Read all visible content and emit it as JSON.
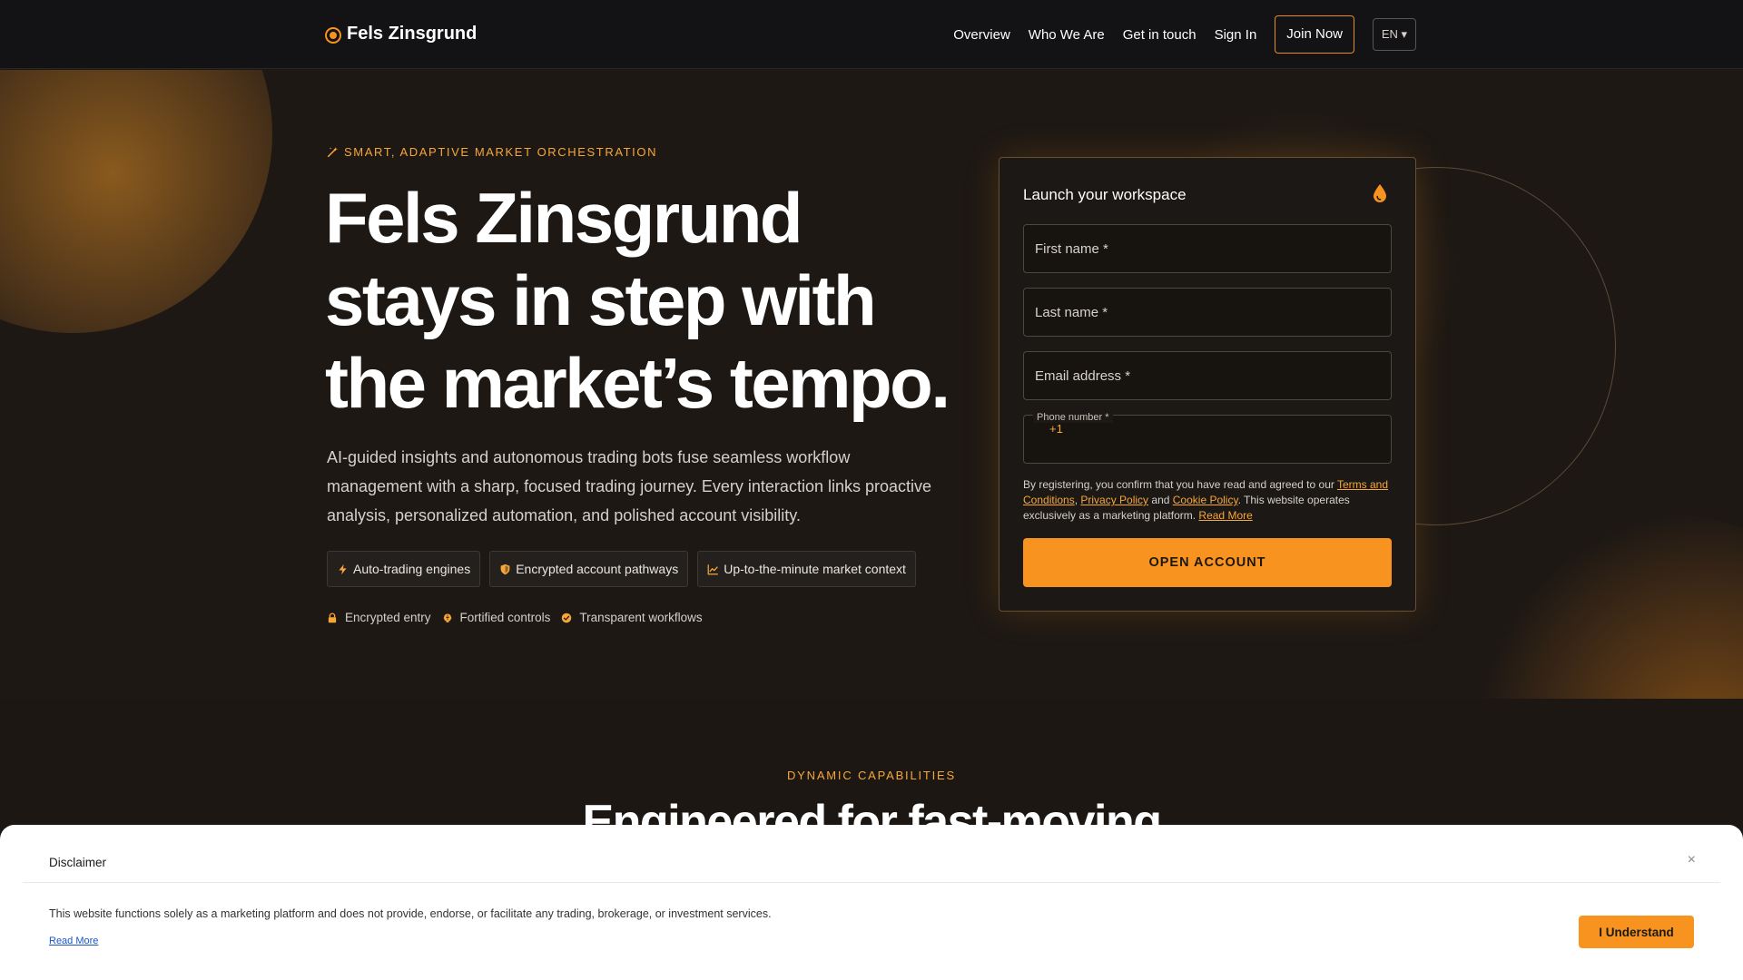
{
  "nav": {
    "brand": "Fels Zinsgrund",
    "links": [
      "Overview",
      "Who We Are",
      "Get in touch",
      "Sign In"
    ],
    "join_label": "Join Now",
    "lang_label": "EN ▾"
  },
  "hero": {
    "eyebrow": "SMART, ADAPTIVE MARKET ORCHESTRATION",
    "headline": "Fels Zinsgrund stays in step with the market’s tempo.",
    "lead": "AI-guided insights and autonomous trading bots fuse seamless workflow management with a sharp, focused trading journey. Every interaction links proactive analysis, personalized automation, and polished account visibility.",
    "chips": [
      "Auto-trading engines",
      "Encrypted account pathways",
      "Up-to-the-minute market context"
    ],
    "trust": [
      "Encrypted entry",
      "Fortified controls",
      "Transparent workflows"
    ]
  },
  "form": {
    "title": "Launch your workspace",
    "first_name_placeholder": "First name *",
    "last_name_placeholder": "Last name *",
    "email_placeholder": "Email address *",
    "phone_label": "Phone number *",
    "phone_code": "+1",
    "legal_prefix": "By registering, you confirm that you have read and agreed to our",
    "terms_link": "Terms and Conditions",
    "privacy_link": "Privacy Policy",
    "cookie_link": "Cookie Policy",
    "legal_suffix": "This website operates exclusively as a marketing platform.",
    "read_more": "Read More",
    "submit_label": "OPEN ACCOUNT"
  },
  "capabilities": {
    "label": "DYNAMIC CAPABILITIES",
    "title": "Engineered for fast-moving"
  },
  "disclaimer": {
    "title": "Disclaimer",
    "close": "×",
    "text": "This website functions solely as a marketing platform and does not provide, endorse, or facilitate any trading, brokerage, or investment services.",
    "read_more": "Read More",
    "accept_label": "I Understand"
  },
  "colors": {
    "accent": "#f7931e",
    "background": "#1c1713",
    "nav_background": "#131215"
  },
  "icons": [
    "brand-dot-icon",
    "sparkle-icon",
    "drop-icon",
    "bolt-icon",
    "shield-icon",
    "chart-icon",
    "lock-icon",
    "brain-icon",
    "check-circle-icon",
    "close-icon"
  ]
}
